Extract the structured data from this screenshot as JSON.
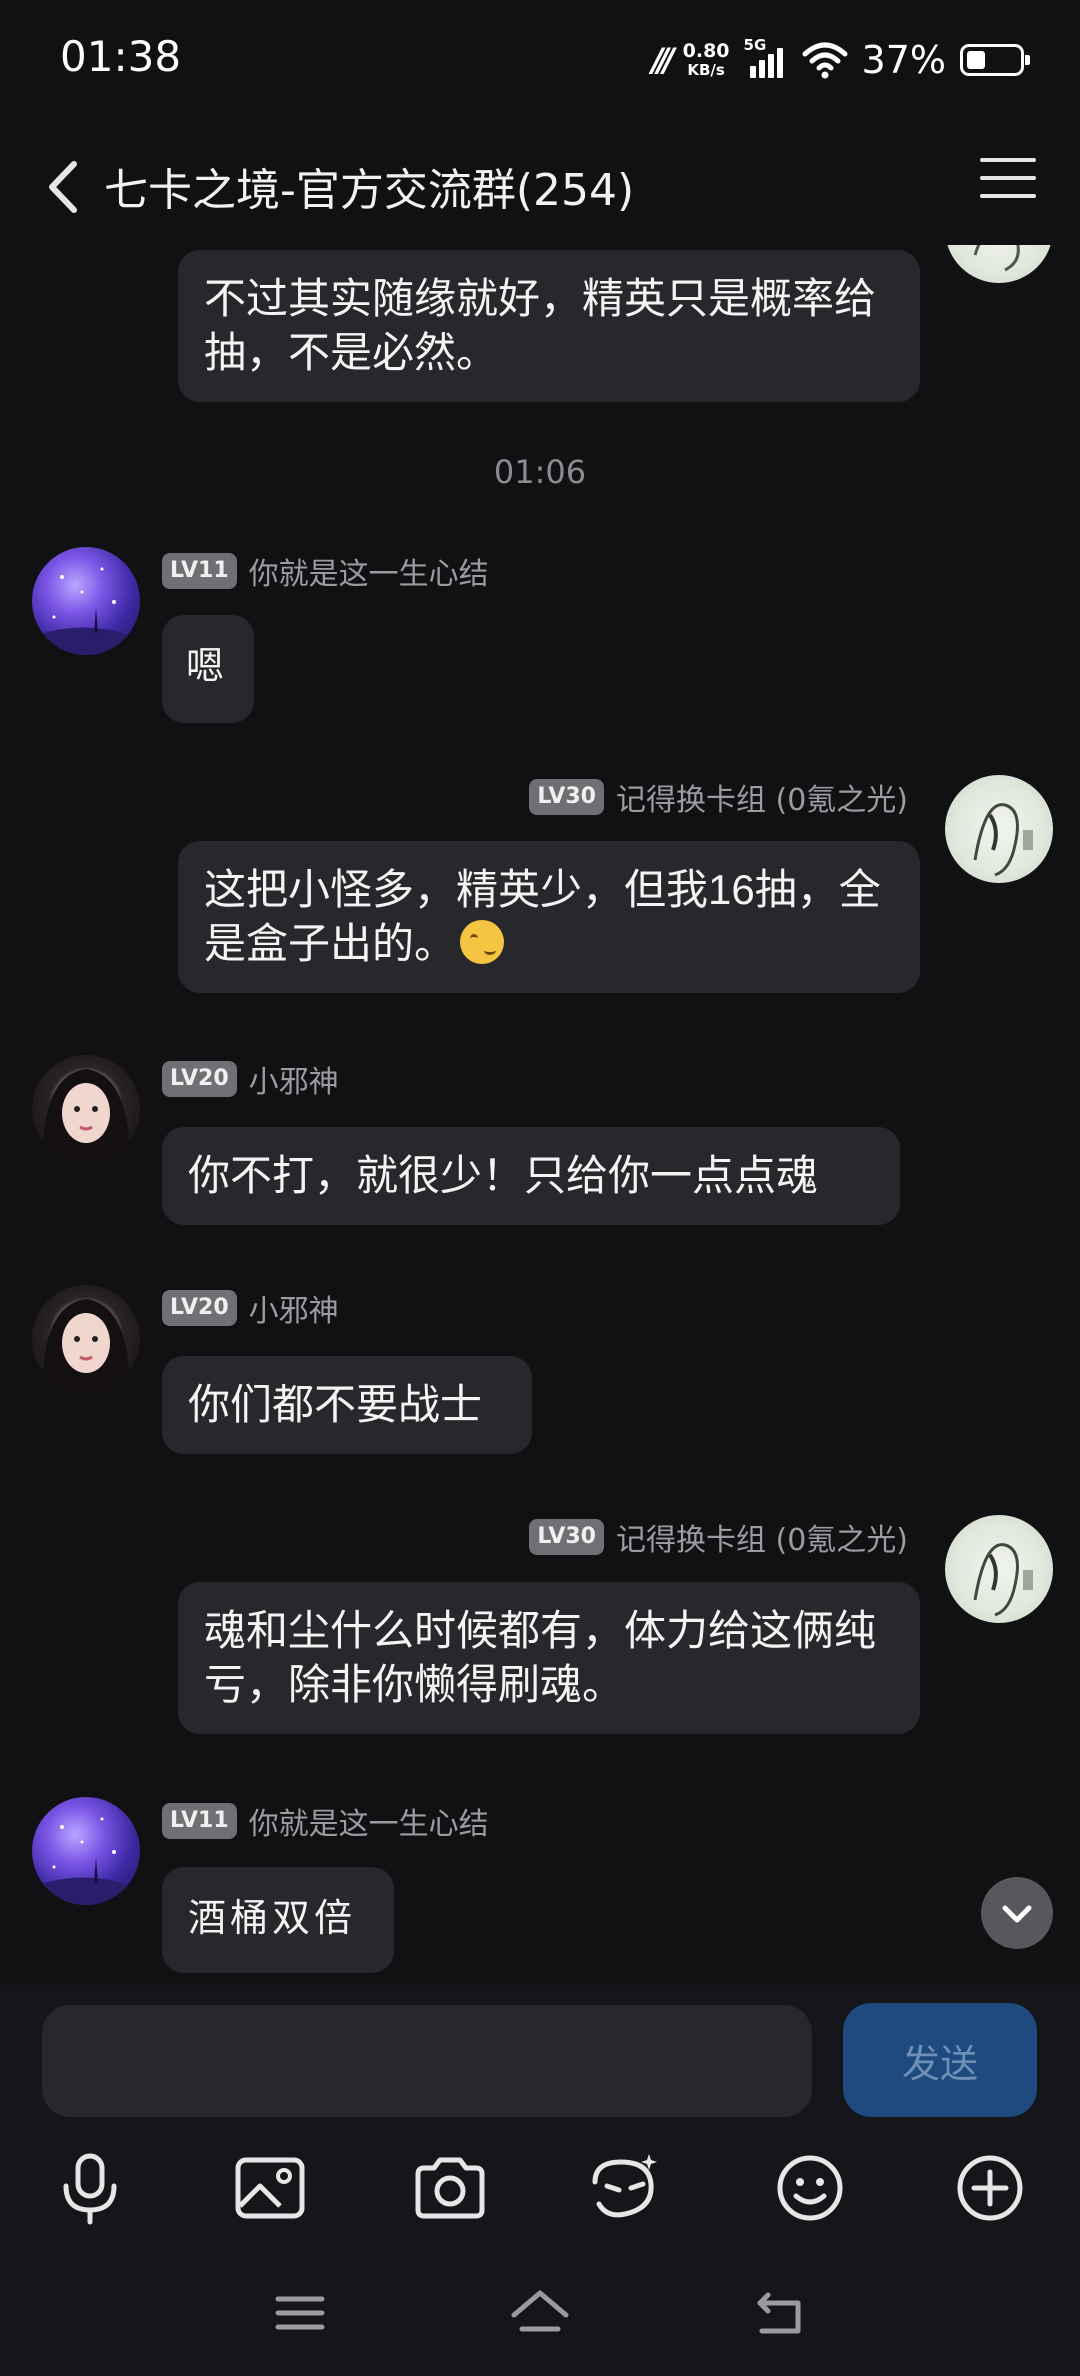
{
  "status_bar": {
    "time": "01:38",
    "net_speed_value": "0.80",
    "net_speed_unit": "KB/s",
    "signal_tag": "5G",
    "battery_percent": "37%",
    "battery_level": 0.37
  },
  "header": {
    "title": "七卡之境-官方交流群(254)",
    "back_icon": "chevron-left-icon",
    "menu_icon": "hamburger-menu-icon"
  },
  "messages": [
    {
      "side": "right",
      "text": "不过其实随缘就好，精英只是概率给抽，不是必然。"
    },
    {
      "time": "01:06"
    },
    {
      "side": "left",
      "level": "LV11",
      "sender": "你就是这一生心结",
      "text": "嗯"
    },
    {
      "side": "right",
      "level": "LV30",
      "sender": "记得换卡组 (0氪之光)",
      "text": "这把小怪多，精英少，但我16抽，全是盒子出的。",
      "emoji": "thinking-face-emoji"
    },
    {
      "side": "left",
      "level": "LV20",
      "sender": "小邪神",
      "text": "你不打，就很少！只给你一点点魂"
    },
    {
      "side": "left",
      "level": "LV20",
      "sender": "小邪神",
      "text": "你们都不要战士"
    },
    {
      "side": "right",
      "level": "LV30",
      "sender": "记得换卡组 (0氪之光)",
      "text": "魂和尘什么时候都有，体力给这俩纯亏，除非你懒得刷魂。"
    },
    {
      "side": "left",
      "level": "LV11",
      "sender": "你就是这一生心结",
      "text": "酒桶双倍"
    }
  ],
  "input": {
    "placeholder": "",
    "send_label": "发送"
  },
  "toolbar": [
    "microphone-icon",
    "image-icon",
    "camera-icon",
    "sticker-icon",
    "emoji-icon",
    "plus-icon"
  ],
  "nav": [
    "recent-apps-icon",
    "home-icon",
    "back-icon"
  ],
  "colors": {
    "background": "#111114",
    "bubble": "#28282c",
    "send_button": "#1f4a80",
    "meta_text": "#9b9ba0"
  }
}
